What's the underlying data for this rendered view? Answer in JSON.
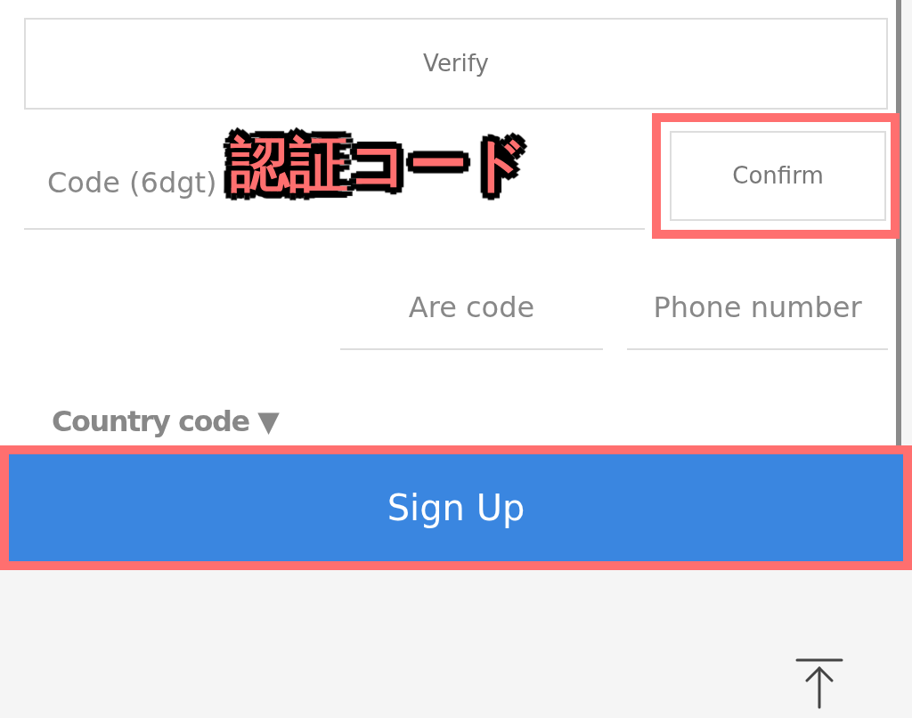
{
  "verify_button": {
    "label": "Verify"
  },
  "code_field": {
    "placeholder": "Code (6dgt)"
  },
  "confirm_button": {
    "label": "Confirm",
    "highlighted": true
  },
  "annotation": {
    "text": "認証コード"
  },
  "area_code_field": {
    "placeholder": "Are code"
  },
  "phone_field": {
    "placeholder": "Phone number"
  },
  "country_code": {
    "label": "Country code",
    "caret": "▼"
  },
  "signup_button": {
    "label": "Sign Up",
    "highlighted": true
  }
}
